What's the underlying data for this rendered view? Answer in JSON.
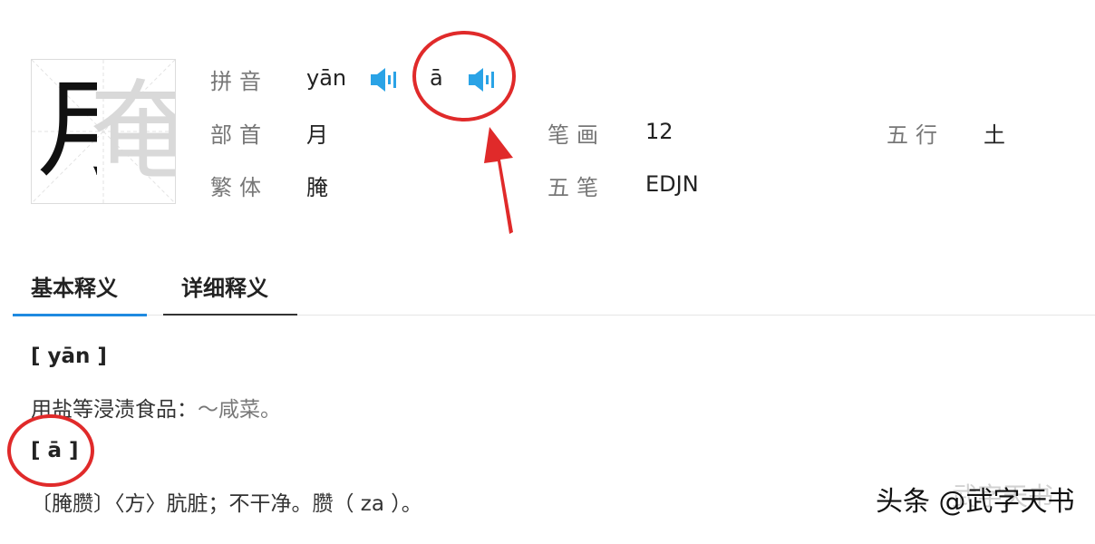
{
  "character": {
    "glyph": "腌",
    "radical_glyph": "月",
    "ghost_glyph": "奄"
  },
  "info": {
    "pinyin_label": "拼音",
    "pinyin_values": [
      "yān",
      "ā"
    ],
    "radical_label": "部首",
    "radical_value": "月",
    "traditional_label": "繁体",
    "traditional_value": "腌",
    "strokes_label": "笔画",
    "strokes_value": "12",
    "wubi_label": "五笔",
    "wubi_value": "EDJN",
    "wuxing_label": "五行",
    "wuxing_value": "土"
  },
  "tabs": [
    {
      "label": "基本释义",
      "active": true
    },
    {
      "label": "详细释义",
      "active": false
    }
  ],
  "definitions": [
    {
      "pron": "[ yān ]",
      "text": "用盐等浸渍食品：",
      "example": "～咸菜。"
    },
    {
      "pron": "[ ā ]",
      "text": "〔腌臜〕〈方〉肮脏；不干净。臜（ za ）。",
      "example": ""
    }
  ],
  "watermark": {
    "text": "头条 @武字天书",
    "ghost_text": "武字天书"
  },
  "colors": {
    "accent_blue": "#1f8ae0",
    "speaker_blue": "#2aa3e6",
    "annotation_red": "#e02a2a"
  }
}
